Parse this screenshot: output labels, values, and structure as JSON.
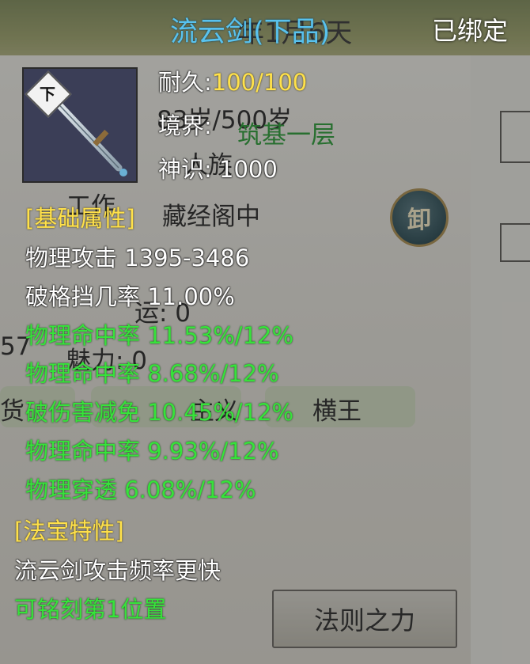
{
  "background": {
    "age": "83岁/500岁",
    "realm_value": "筑基一层",
    "label_clan": "人族",
    "work_label": "工作",
    "work_value": "藏经阁中",
    "stat_a": "运: 0",
    "num_fragment": "57",
    "charm": "魅力: 0",
    "tag_left": "货",
    "tag_mid": "主义",
    "tag_right": "横王",
    "law_button": "法则之力",
    "seal_char": "卸",
    "date_fragment": "年1月6天"
  },
  "item": {
    "name": "流云剑(下品)",
    "bound_status": "已绑定",
    "grade_badge": "下",
    "durability_label": "耐久:",
    "durability_value": "100/100",
    "realm_label": "境界:",
    "realm_value": "筑基一层",
    "spirit_label": "神识:",
    "spirit_value": "1000"
  },
  "base_section": {
    "header": "[基础属性]",
    "lines": [
      "物理攻击 1395-3486",
      "破格挡几率 11.00%"
    ]
  },
  "bonus_lines": [
    "物理命中率 11.53%/12%",
    "物理命中率 8.68%/12%",
    "破伤害减免 10.45%/12%",
    "物理命中率 9.93%/12%",
    "物理穿透 6.08%/12%"
  ],
  "treasure_section": {
    "header": "[法宝特性]",
    "description": "流云剑攻击频率更快",
    "engrave": "可铭刻第1位置"
  },
  "colors": {
    "title": "#59c2ee",
    "header": "#ffe14a",
    "bonus": "#36e33a",
    "text": "#ffffff"
  },
  "icons": [
    "sword-icon",
    "grade-badge-icon",
    "seal-icon"
  ]
}
